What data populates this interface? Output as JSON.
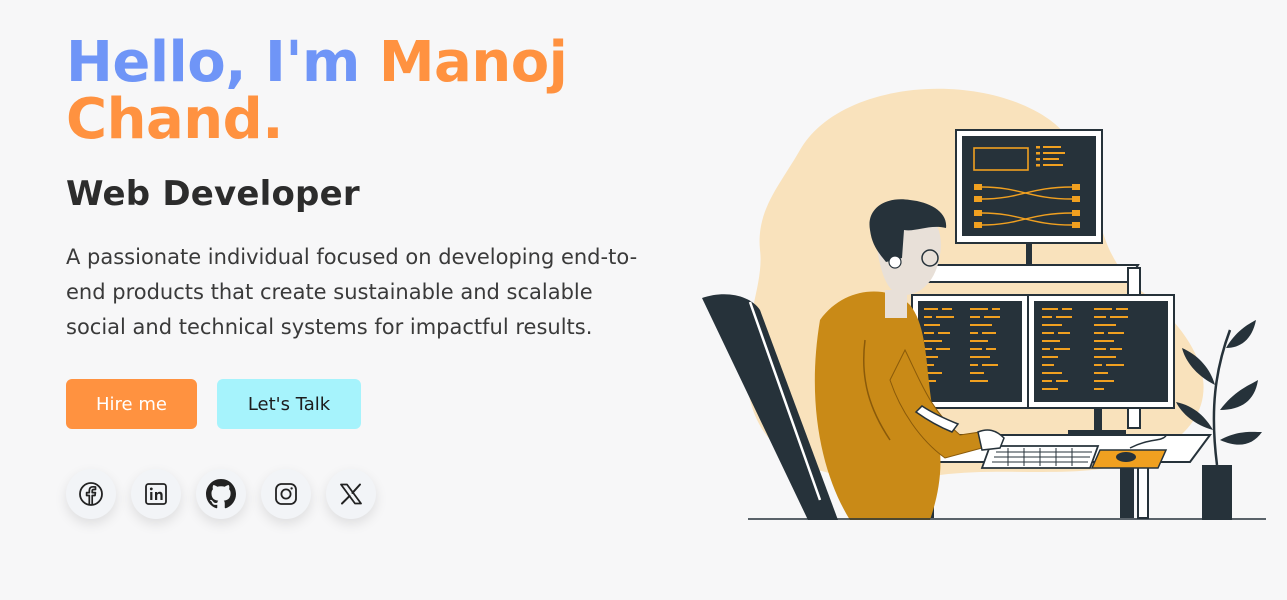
{
  "hero": {
    "greeting": "Hello, I'm ",
    "name_line1": "Manoj",
    "name_line2": "Chand.",
    "role": "Web Developer",
    "bio": "A passionate individual focused on developing end-to-end products that create sustainable and scalable social and technical systems for impactful results."
  },
  "buttons": {
    "hire": "Hire me",
    "talk": "Let's Talk"
  },
  "socials": [
    {
      "icon": "facebook-icon"
    },
    {
      "icon": "linkedin-icon"
    },
    {
      "icon": "github-icon"
    },
    {
      "icon": "instagram-icon"
    },
    {
      "icon": "x-icon"
    }
  ],
  "colors": {
    "greeting": "#6f95f7",
    "accent": "#ff9240",
    "talk_button": "#a6f3fc",
    "blob": "#f9e2bc",
    "monitor_dark": "#26323a",
    "shirt": "#c98a17"
  }
}
